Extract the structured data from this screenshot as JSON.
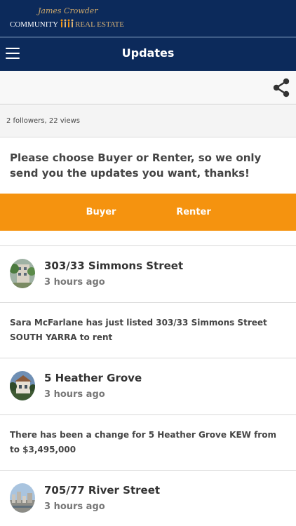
{
  "brand": {
    "script_name": "James Crowder",
    "line_left": "COMMUNITY",
    "line_right": "REAL ESTATE",
    "colors": {
      "navy": "#0c2a5b",
      "gold": "#c9a56a",
      "orange": "#f5930f"
    }
  },
  "header": {
    "title": "Updates",
    "menu_icon": "hamburger-icon",
    "share_icon": "share-icon"
  },
  "stats": {
    "text": "2 followers, 22 views"
  },
  "prompt": {
    "text": "Please choose Buyer or Renter, so we only send you the updates you want, thanks!"
  },
  "choice": {
    "buyer_label": "Buyer",
    "renter_label": "Renter"
  },
  "feed": [
    {
      "title": "303/33 Simmons Street",
      "time": "3 hours ago",
      "message": "Sara McFarlane has just listed 303/33 Simmons Street SOUTH YARRA to rent"
    },
    {
      "title": "5 Heather Grove",
      "time": "3 hours ago",
      "message": "There has been a change for 5 Heather Grove KEW from  to $3,495,000"
    },
    {
      "title": "705/77 River Street",
      "time": "3 hours ago",
      "message": ""
    }
  ]
}
